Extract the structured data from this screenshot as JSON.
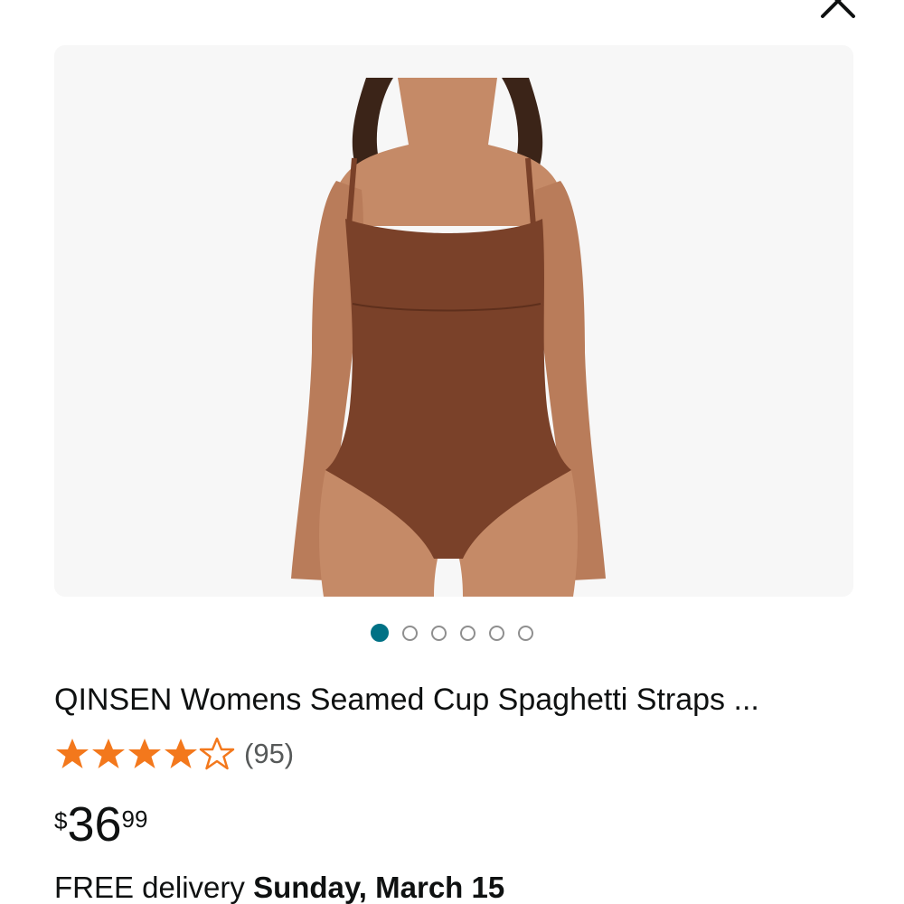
{
  "header": {
    "close_icon": "close-icon"
  },
  "product_image": {
    "image_count": 6,
    "active_index": 0,
    "colors": {
      "background": "#f7f7f7",
      "garment": "#7a4129",
      "skin": "#c58a67",
      "hair": "#3b2418"
    }
  },
  "product": {
    "title": "QINSEN Womens Seamed Cup Spaghetti Straps ...",
    "rating": 4.5,
    "rating_max": 5,
    "review_count": "(95)",
    "price": {
      "symbol": "$",
      "whole": "36",
      "fraction": "99"
    },
    "delivery": {
      "label": "FREE delivery",
      "date": "Sunday, March 15"
    }
  },
  "colors": {
    "accent_teal": "#007185",
    "star_orange": "#f3781c",
    "muted_text": "#565959"
  }
}
